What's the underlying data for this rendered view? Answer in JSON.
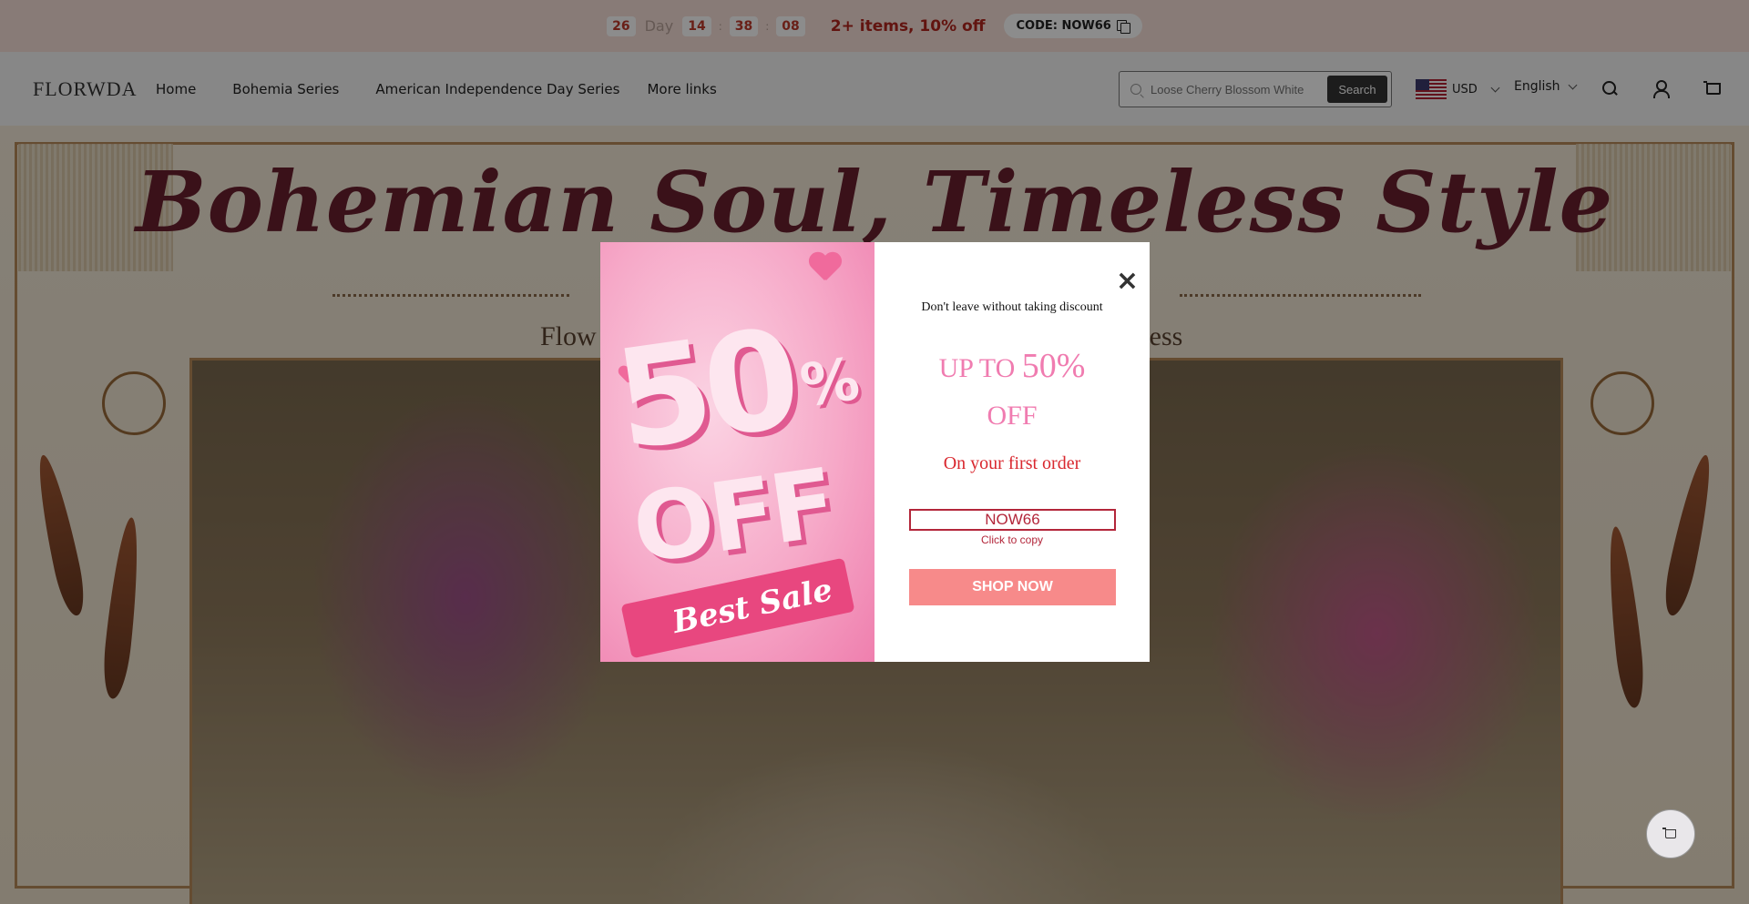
{
  "announcement": {
    "days": "26",
    "day_label": "Day",
    "hours": "14",
    "minutes": "38",
    "seconds": "08",
    "sep": ":",
    "promo": "2+ items, 10% off",
    "code_label": "CODE: NOW66"
  },
  "header": {
    "logo": "FLORWDA",
    "nav": [
      "Home",
      "Bohemia Series",
      "American Independence Day Series",
      "More links"
    ],
    "search_placeholder": "Loose Cherry Blossom White",
    "search_button": "Search",
    "currency": "USD",
    "language": "English"
  },
  "hero": {
    "title": "Bohemian Soul, Timeless Style",
    "subtitle_left": "Flow",
    "subtitle_right": "eless"
  },
  "modal": {
    "lead": "Don't leave without taking discount",
    "up_to": "UP TO",
    "percent": "50%",
    "off": "OFF",
    "first_order": "On your first order",
    "code": "NOW66",
    "copy_hint": "Click to copy",
    "shop_now": "SHOP NOW",
    "image_text_big": "50",
    "image_text_pct": "%",
    "image_text_off": "OFF",
    "image_text_best": "Best Sale",
    "close": "×"
  },
  "colors": {
    "accent_pink": "#f07cb0",
    "accent_red": "#d9272e",
    "button_salmon": "#f78a8a",
    "hero_title": "#6b1f2e"
  },
  "icons": [
    "copy-icon",
    "search-icon",
    "user-icon",
    "cart-icon",
    "chevron-down-icon",
    "close-icon",
    "flag-us-icon"
  ]
}
